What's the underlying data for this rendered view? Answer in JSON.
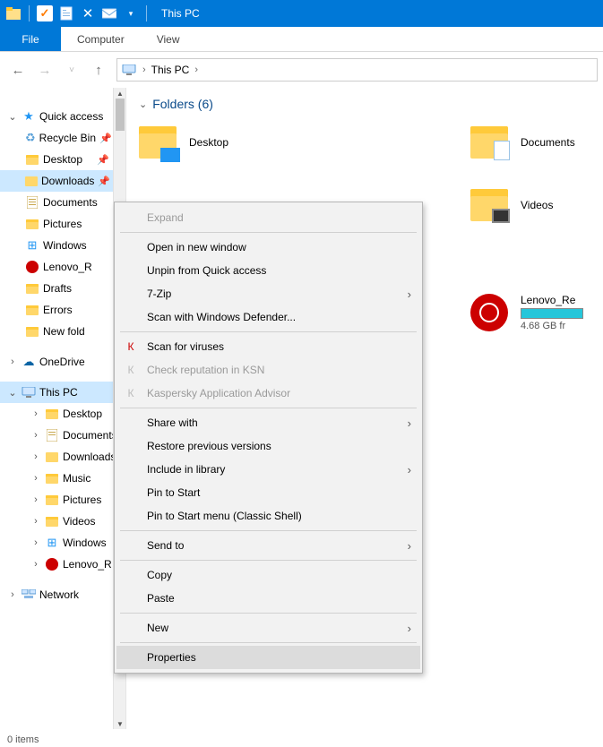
{
  "titlebar": {
    "title": "This PC"
  },
  "ribbon": {
    "file": "File",
    "tab_computer": "Computer",
    "tab_view": "View"
  },
  "breadcrumb": {
    "text": "This PC"
  },
  "tree": {
    "quick_access": "Quick access",
    "recycle": "Recycle Bin",
    "desktop": "Desktop",
    "downloads": "Downloads",
    "documents": "Documents",
    "pictures": "Pictures",
    "windows": "Windows",
    "lenovo_r": "Lenovo_R",
    "drafts": "Drafts",
    "errors": "Errors",
    "newfold": "New fold",
    "onedrive": "OneDrive",
    "thispc": "This PC",
    "pc_desktop": "Desktop",
    "pc_documents": "Documents",
    "pc_downloads": "Downloads",
    "pc_music": "Music",
    "pc_pictures": "Pictures",
    "pc_videos": "Videos",
    "pc_windows": "Windows",
    "pc_lenovo_r": "Lenovo_R",
    "network": "Network"
  },
  "content": {
    "section": "Folders (6)",
    "desktop": "Desktop",
    "documents": "Documents",
    "videos": "Videos",
    "drive_name": "Lenovo_Re",
    "drive_free": "4.68 GB fr"
  },
  "ctx": {
    "expand": "Expand",
    "open_new": "Open in new window",
    "unpin": "Unpin from Quick access",
    "sevenzip": "7-Zip",
    "defender": "Scan with Windows Defender...",
    "scan_virus": "Scan for viruses",
    "ksn": "Check reputation in KSN",
    "kaspersky": "Kaspersky Application Advisor",
    "share": "Share with",
    "restore": "Restore previous versions",
    "include": "Include in library",
    "pin_start": "Pin to Start",
    "pin_classic": "Pin to Start menu (Classic Shell)",
    "send_to": "Send to",
    "copy": "Copy",
    "paste": "Paste",
    "new": "New",
    "properties": "Properties"
  },
  "status": "0 items"
}
